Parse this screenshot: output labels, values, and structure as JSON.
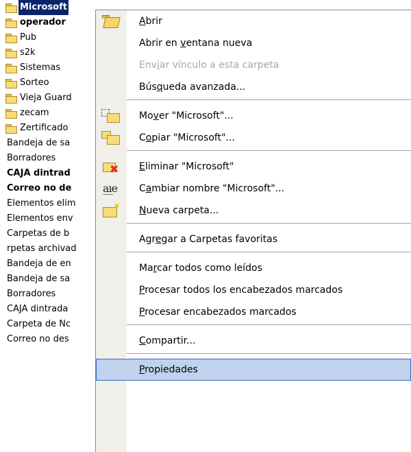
{
  "folder_list": [
    {
      "label": "Microsoft",
      "icon": "folder-icon",
      "bold": true,
      "selected": true
    },
    {
      "label": "operador",
      "icon": "folder-icon",
      "bold": true,
      "selected": false
    },
    {
      "label": "Pub",
      "icon": "folder-icon",
      "bold": false,
      "selected": false
    },
    {
      "label": "s2k",
      "icon": "folder-icon",
      "bold": false,
      "selected": false
    },
    {
      "label": "Sistemas",
      "icon": "folder-icon",
      "bold": false,
      "selected": false
    },
    {
      "label": "Sorteo",
      "icon": "folder-icon",
      "bold": false,
      "selected": false
    },
    {
      "label": "Vieja Guard",
      "icon": "folder-icon",
      "bold": false,
      "selected": false
    },
    {
      "label": "zecam",
      "icon": "folder-icon",
      "bold": false,
      "selected": false
    },
    {
      "label": "Zertificado",
      "icon": "folder-icon",
      "bold": false,
      "selected": false
    },
    {
      "label": "Bandeja de sa",
      "icon": "",
      "bold": false,
      "selected": false
    },
    {
      "label": "Borradores",
      "icon": "",
      "bold": false,
      "selected": false
    },
    {
      "label": "CAJA dintrad",
      "icon": "",
      "bold": true,
      "selected": false
    },
    {
      "label": "Correo no de",
      "icon": "",
      "bold": true,
      "selected": false
    },
    {
      "label": "Elementos elim",
      "icon": "",
      "bold": false,
      "selected": false
    },
    {
      "label": "Elementos env",
      "icon": "",
      "bold": false,
      "selected": false
    },
    {
      "label": "Carpetas de b",
      "icon": "",
      "bold": false,
      "selected": false
    },
    {
      "label": "rpetas archivad",
      "icon": "",
      "bold": false,
      "selected": false
    },
    {
      "label": "Bandeja de en",
      "icon": "",
      "bold": false,
      "selected": false
    },
    {
      "label": "Bandeja de sa",
      "icon": "",
      "bold": false,
      "selected": false
    },
    {
      "label": "Borradores",
      "icon": "",
      "bold": false,
      "selected": false
    },
    {
      "label": "CAJA dintrada",
      "icon": "",
      "bold": false,
      "selected": false
    },
    {
      "label": "Carpeta de Nc",
      "icon": "",
      "bold": false,
      "selected": false
    },
    {
      "label": "Correo no des",
      "icon": "",
      "bold": false,
      "selected": false
    }
  ],
  "context_menu": {
    "items": [
      {
        "pre": "",
        "acc": "A",
        "post": "brir",
        "icon": "open-folder-icon",
        "enabled": true,
        "highlighted": false
      },
      {
        "pre": "Abrir en ",
        "acc": "v",
        "post": "entana nueva",
        "icon": "",
        "enabled": true,
        "highlighted": false
      },
      {
        "pre": "Env",
        "acc": "i",
        "post": "ar vínculo a esta carpeta",
        "icon": "",
        "enabled": false,
        "highlighted": false
      },
      {
        "pre": "Bús",
        "acc": "q",
        "post": "ueda avanzada...",
        "icon": "",
        "enabled": true,
        "highlighted": false
      },
      {
        "pre": "Mo",
        "acc": "v",
        "post": "er \"Microsoft\"...",
        "icon": "move-folder-icon",
        "enabled": true,
        "highlighted": false
      },
      {
        "pre": "C",
        "acc": "o",
        "post": "piar \"Microsoft\"...",
        "icon": "copy-folder-icon",
        "enabled": true,
        "highlighted": false
      },
      {
        "pre": "",
        "acc": "E",
        "post": "liminar \"Microsoft\"",
        "icon": "delete-folder-icon",
        "enabled": true,
        "highlighted": false
      },
      {
        "pre": "C",
        "acc": "a",
        "post": "mbiar nombre \"Microsoft\"...",
        "icon": "rename-icon",
        "enabled": true,
        "highlighted": false
      },
      {
        "pre": "",
        "acc": "N",
        "post": "ueva carpeta...",
        "icon": "new-folder-icon",
        "enabled": true,
        "highlighted": false
      },
      {
        "pre": "Agr",
        "acc": "e",
        "post": "gar a Carpetas favoritas",
        "icon": "",
        "enabled": true,
        "highlighted": false
      },
      {
        "pre": "Ma",
        "acc": "r",
        "post": "car todos como leídos",
        "icon": "",
        "enabled": true,
        "highlighted": false
      },
      {
        "pre": "",
        "acc": "P",
        "post": "rocesar todos los encabezados marcados",
        "icon": "",
        "enabled": true,
        "highlighted": false
      },
      {
        "pre": "",
        "acc": "P",
        "post": "rocesar encabezados marcados",
        "icon": "",
        "enabled": true,
        "highlighted": false
      },
      {
        "pre": "",
        "acc": "C",
        "post": "ompartir...",
        "icon": "",
        "enabled": true,
        "highlighted": false
      },
      {
        "pre": "",
        "acc": "P",
        "post": "ropiedades",
        "icon": "",
        "enabled": true,
        "highlighted": true
      }
    ]
  }
}
